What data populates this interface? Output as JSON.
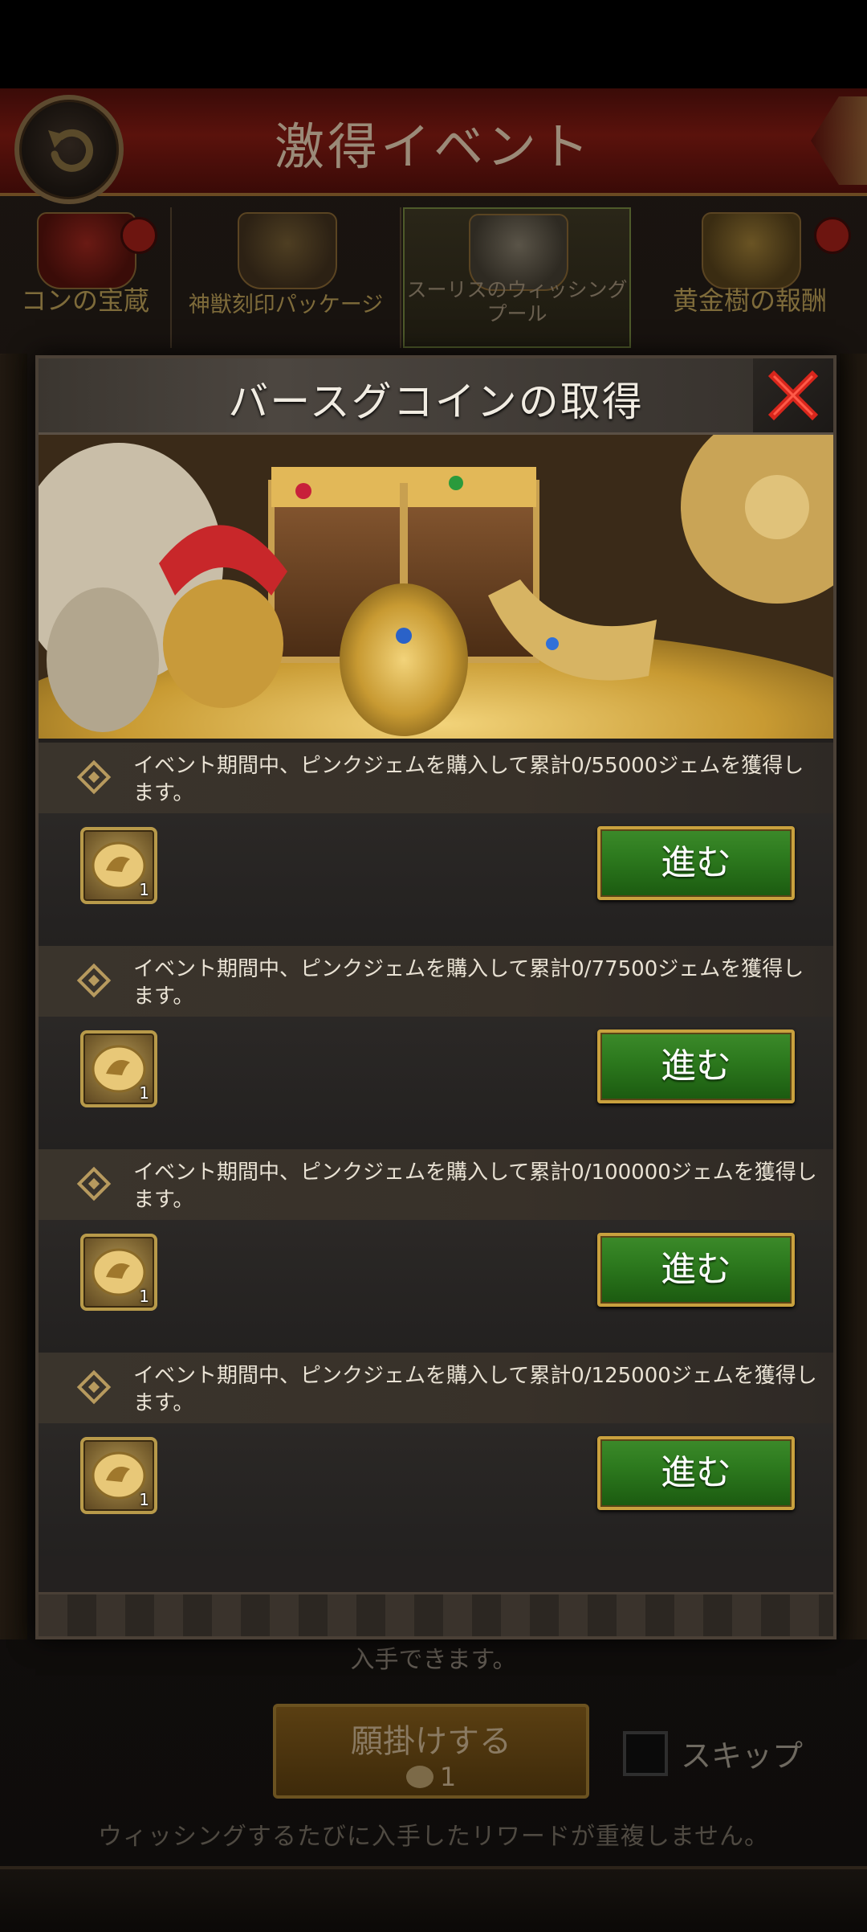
{
  "header": {
    "title": "激得イベント"
  },
  "tabs": [
    {
      "label": "コンの宝蔵",
      "badge": true
    },
    {
      "label": "神獣刻印パッケージ",
      "badge": false
    },
    {
      "label": "スーリスのウィッシングプール",
      "badge": false,
      "active": true
    },
    {
      "label": "黄金樹の報酬",
      "badge": true
    }
  ],
  "modal": {
    "title": "バースグコインの取得",
    "tasks": [
      {
        "text": "イベント期間中、ピンクジェムを購入して累計0/55000ジェムを獲得します。",
        "reward_count": "1",
        "button": "進む"
      },
      {
        "text": "イベント期間中、ピンクジェムを購入して累計0/77500ジェムを獲得します。",
        "reward_count": "1",
        "button": "進む"
      },
      {
        "text": "イベント期間中、ピンクジェムを購入して累計0/100000ジェムを獲得します。",
        "reward_count": "1",
        "button": "進む"
      },
      {
        "text": "イベント期間中、ピンクジェムを購入して累計0/125000ジェムを獲得します。",
        "reward_count": "1",
        "button": "進む"
      }
    ]
  },
  "bottom": {
    "hint": "入手できます。",
    "wish_button": "願掛けする",
    "wish_cost": "1",
    "skip_label": "スキップ",
    "note": "ウィッシングするたびに入手したリワードが重複しません。"
  },
  "colors": {
    "go_button_green": "#2d7a1e",
    "go_button_border": "#c9a13e",
    "close_red": "#d8261c",
    "modal_title": "#f1ece2"
  },
  "icons": {
    "back": "back-arrow-icon",
    "close": "close-x-icon",
    "task_marker": "diamond-icon",
    "reward": "gold-coin-icon"
  }
}
